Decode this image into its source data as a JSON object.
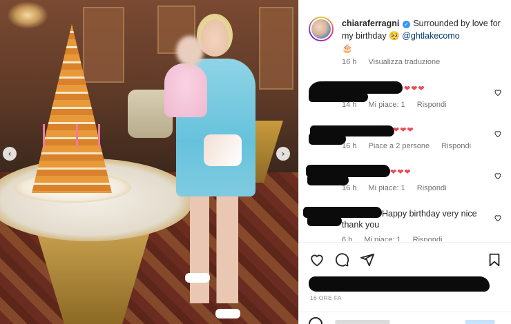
{
  "post": {
    "username": "chiaraferragni",
    "caption_text": "Surrounded by love for my birthday",
    "caption_emoji": "🥺",
    "mention": "@ghtlakecomo",
    "cake_emoji": "🎂",
    "time": "16 h",
    "see_translation": "Visualizza traduzione",
    "time_ago": "16 ORE FA"
  },
  "comments": [
    {
      "hearts": "❤❤❤",
      "text": "",
      "time": "14 h",
      "likes": "Mi piace: 1",
      "reply": "Rispondi"
    },
    {
      "hearts": "❤❤❤",
      "text": "",
      "time": "16 h",
      "likes": "Piace a 2 persone",
      "reply": "Rispondi"
    },
    {
      "hearts": "❤❤❤",
      "text": "",
      "time": "16 h",
      "likes": "Mi piace: 1",
      "reply": "Rispondi"
    },
    {
      "hearts": "",
      "text": "Happy birthday very nice",
      "text2": "thank you",
      "time": "6 h",
      "likes": "Mi piace: 1",
      "reply": "Rispondi"
    }
  ],
  "nav": {
    "prev": "‹",
    "next": "›"
  },
  "colors": {
    "heart": "#ed4956",
    "link": "#00376b",
    "verified": "#3897f0"
  }
}
